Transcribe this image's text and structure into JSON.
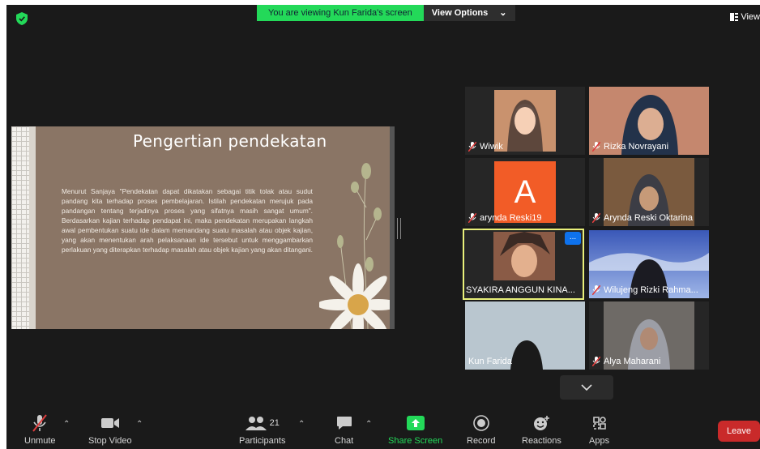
{
  "banner": {
    "viewing_text": "You are viewing Kun Farida's screen",
    "view_options": "View Options"
  },
  "view_button": "View",
  "slide": {
    "title": "Pengertian pendekatan",
    "body": "Menurut Sanjaya \"Pendekatan dapat dikatakan sebagai titik tolak atau sudut pandang kita terhadap proses pembelajaran. Istilah pendekatan merujuk pada pandangan tentang terjadinya proses yang sifatnya masih sangat umum\". Berdasarkan kajian terhadap pendapat ini, maka pendekatan merupakan langkah awal pembentukan suatu ide dalam memandang suatu masalah atau objek kajian, yang akan menentukan arah pelaksanaan ide tersebut untuk menggambarkan perlakuan yang diterapkan terhadap masalah atau objek kajian yang akan ditangani."
  },
  "participants_tiles": [
    {
      "name": "Wiwik",
      "muted": true
    },
    {
      "name": "Rizka Novrayani",
      "muted": true
    },
    {
      "name": "arynda Reski19",
      "muted": true,
      "avatar_letter": "A"
    },
    {
      "name": "Arynda Reski Oktarina",
      "muted": true
    },
    {
      "name": "SYAKIRA ANGGUN KINA...",
      "muted": false,
      "active_speaker": true,
      "more": "..."
    },
    {
      "name": "Wilujeng Rizki Rahma...",
      "muted": true
    },
    {
      "name": "Kun Farida",
      "muted": false
    },
    {
      "name": "Alya Maharani",
      "muted": true
    }
  ],
  "toolbar": {
    "unmute": "Unmute",
    "stop_video": "Stop Video",
    "participants": "Participants",
    "participants_count": "21",
    "chat": "Chat",
    "share_screen": "Share Screen",
    "record": "Record",
    "reactions": "Reactions",
    "apps": "Apps",
    "leave": "Leave"
  },
  "colors": {
    "share_green": "#23d959",
    "leave_red": "#c92a2a",
    "active_outline": "#e9f07a",
    "avatar_orange": "#f25c27"
  }
}
